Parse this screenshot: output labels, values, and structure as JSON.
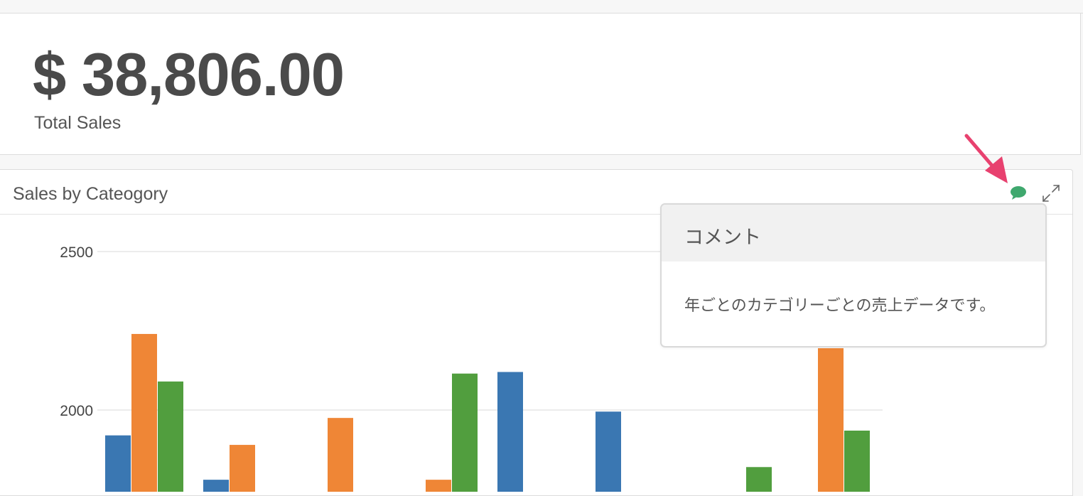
{
  "kpi": {
    "value": "$ 38,806.00",
    "label": "Total Sales"
  },
  "chart_panel": {
    "title": "Sales by Cateogory",
    "comment_icon": "comment-bubble-icon",
    "expand_icon": "expand-arrows-icon"
  },
  "comment_popover": {
    "title": "コメント",
    "body": "年ごとのカテゴリーごとの売上データです。"
  },
  "colors": {
    "series_blue": "#3a77b2",
    "series_orange": "#ef8636",
    "series_green": "#519e3e",
    "comment_icon": "#3fa86e",
    "annotation_arrow": "#e8416f"
  },
  "chart_data": {
    "type": "bar",
    "ylim": [
      1750,
      2600
    ],
    "yticks": [
      2000,
      2500
    ],
    "grid": true,
    "series": [
      {
        "values": [
          1920,
          1780,
          null,
          null,
          2120,
          1995,
          null,
          null
        ]
      },
      {
        "values": [
          2240,
          1890,
          1975,
          1780,
          null,
          null,
          null,
          2195
        ]
      },
      {
        "values": [
          2090,
          null,
          null,
          2115,
          null,
          null,
          1820,
          1935
        ]
      }
    ]
  }
}
